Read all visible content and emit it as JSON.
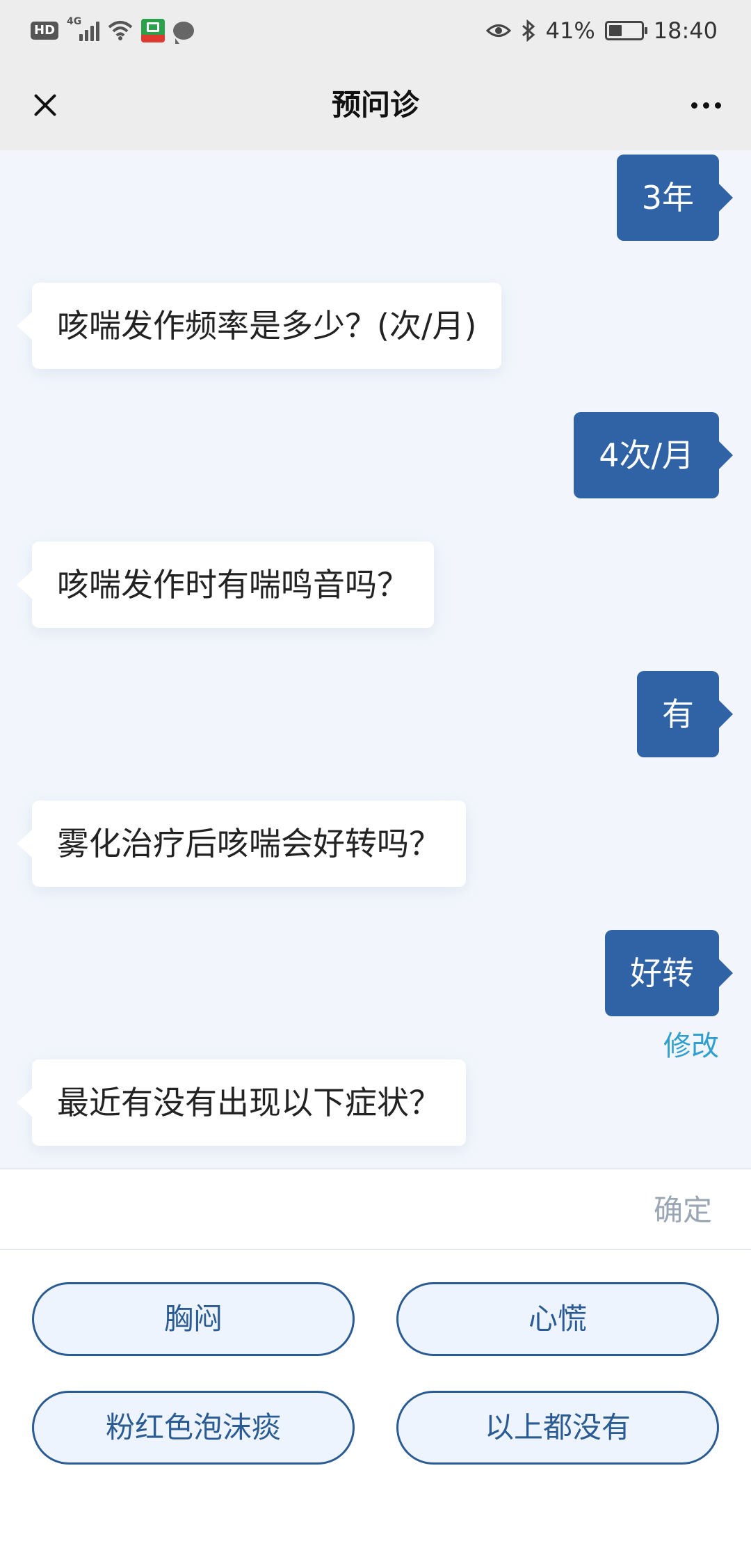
{
  "status_bar": {
    "network_badge": "HD",
    "network_type": "4G",
    "battery_percent": "41%",
    "battery_level": 0.41,
    "time": "18:40"
  },
  "header": {
    "title": "预问诊"
  },
  "chat": {
    "messages": [
      {
        "role": "user",
        "text": "3年"
      },
      {
        "role": "bot",
        "text": "咳喘发作频率是多少？(次/月)"
      },
      {
        "role": "user",
        "text": "4次/月"
      },
      {
        "role": "bot",
        "text": "咳喘发作时有喘鸣音吗？"
      },
      {
        "role": "user",
        "text": "有"
      },
      {
        "role": "bot",
        "text": "雾化治疗后咳喘会好转吗？"
      },
      {
        "role": "user",
        "text": "好转"
      },
      {
        "role": "bot",
        "text": "最近有没有出现以下症状？"
      }
    ],
    "edit_label": "修改"
  },
  "confirm": {
    "label": "确定"
  },
  "options": [
    "胸闷",
    "心慌",
    "粉红色泡沫痰",
    "以上都没有"
  ],
  "colors": {
    "accent": "#2f63a5",
    "chat_background": "#f2f6fc",
    "link": "#2f9fd0"
  }
}
